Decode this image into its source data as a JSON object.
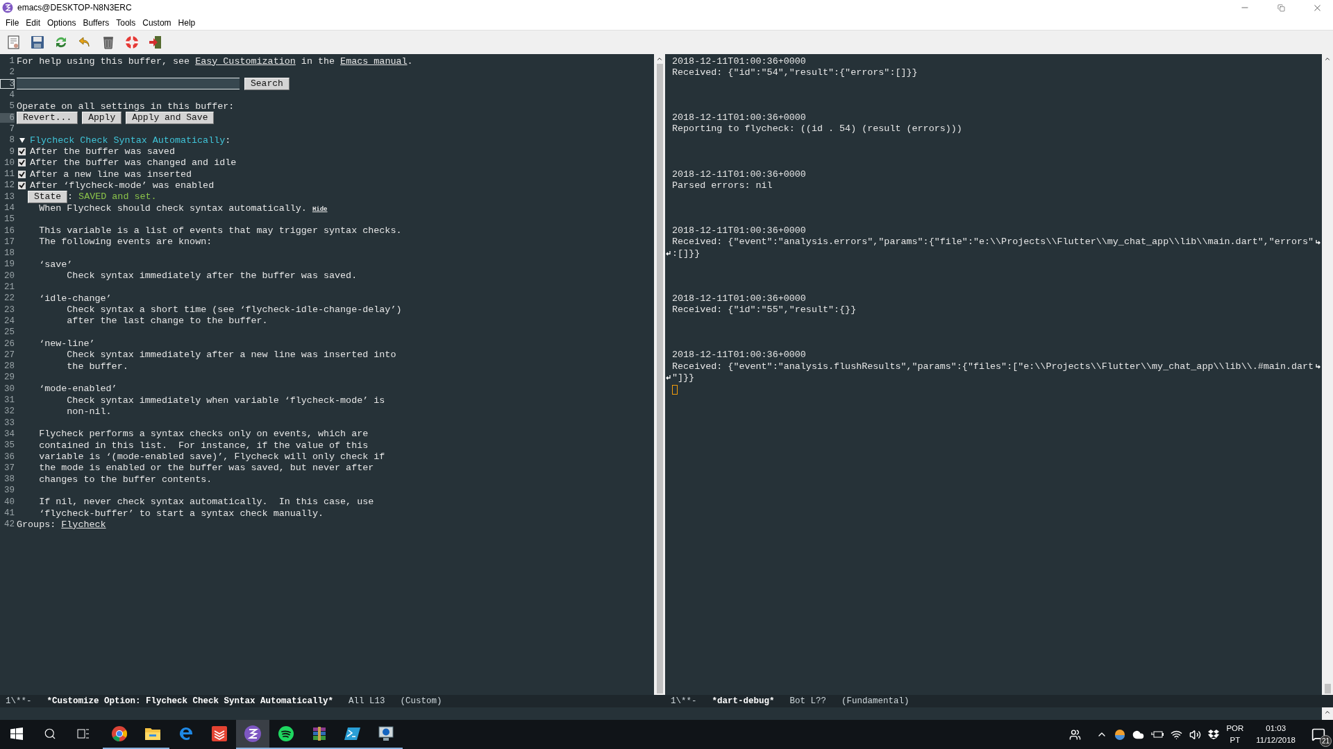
{
  "window": {
    "title": "emacs@DESKTOP-N8N3ERC"
  },
  "menu": [
    "File",
    "Edit",
    "Options",
    "Buffers",
    "Tools",
    "Custom",
    "Help"
  ],
  "left_buffer": {
    "lines": [
      {
        "number": "1",
        "kind": "text",
        "parts": [
          {
            "text": "For help using this buffer, see "
          },
          {
            "text": "Easy Customization",
            "link": true
          },
          {
            "text": " in the "
          },
          {
            "text": "Emacs manual",
            "link": true
          },
          {
            "text": "."
          }
        ]
      },
      {
        "number": "2",
        "kind": "blank"
      },
      {
        "number": "3",
        "kind": "search",
        "cursor": true,
        "button": "Search"
      },
      {
        "number": "4",
        "kind": "blank"
      },
      {
        "number": "5",
        "kind": "text",
        "parts": [
          {
            "text": "Operate on all settings in this buffer:"
          }
        ]
      },
      {
        "number": "6",
        "kind": "buttons",
        "marked": true,
        "buttons": [
          "Revert...",
          "Apply",
          "Apply and Save"
        ]
      },
      {
        "number": "7",
        "kind": "blank"
      },
      {
        "number": "8",
        "kind": "heading",
        "expanded": true,
        "title": "Flycheck Check Syntax Automatically",
        "suffix": ":"
      },
      {
        "number": "9",
        "kind": "checkbox",
        "checked": true,
        "label": "After the buffer was saved"
      },
      {
        "number": "10",
        "kind": "checkbox",
        "checked": true,
        "label": "After the buffer was changed and idle"
      },
      {
        "number": "11",
        "kind": "checkbox",
        "checked": true,
        "label": "After a new line was inserted"
      },
      {
        "number": "12",
        "kind": "checkbox",
        "checked": true,
        "label": "After ‘flycheck-mode’ was enabled"
      },
      {
        "number": "13",
        "kind": "state",
        "button": "State",
        "separator": ":",
        "status": "SAVED and set."
      },
      {
        "number": "14",
        "kind": "text",
        "parts": [
          {
            "text": "    When Flycheck should check syntax automatically. "
          },
          {
            "text": "Hide",
            "link": true,
            "small": true
          }
        ]
      },
      {
        "number": "15",
        "kind": "blank"
      },
      {
        "number": "16",
        "kind": "text",
        "parts": [
          {
            "text": "    This variable is a list of events that may trigger syntax checks."
          }
        ]
      },
      {
        "number": "17",
        "kind": "text",
        "parts": [
          {
            "text": "    The following events are known:"
          }
        ]
      },
      {
        "number": "18",
        "kind": "blank"
      },
      {
        "number": "19",
        "kind": "text",
        "parts": [
          {
            "text": "    ‘save’"
          }
        ]
      },
      {
        "number": "20",
        "kind": "text",
        "parts": [
          {
            "text": "         Check syntax immediately after the buffer was saved."
          }
        ]
      },
      {
        "number": "21",
        "kind": "blank"
      },
      {
        "number": "22",
        "kind": "text",
        "parts": [
          {
            "text": "    ‘idle-change’"
          }
        ]
      },
      {
        "number": "23",
        "kind": "text",
        "parts": [
          {
            "text": "         Check syntax a short time (see ‘flycheck-idle-change-delay’)"
          }
        ]
      },
      {
        "number": "24",
        "kind": "text",
        "parts": [
          {
            "text": "         after the last change to the buffer."
          }
        ]
      },
      {
        "number": "25",
        "kind": "blank"
      },
      {
        "number": "26",
        "kind": "text",
        "parts": [
          {
            "text": "    ‘new-line’"
          }
        ]
      },
      {
        "number": "27",
        "kind": "text",
        "parts": [
          {
            "text": "         Check syntax immediately after a new line was inserted into"
          }
        ]
      },
      {
        "number": "28",
        "kind": "text",
        "parts": [
          {
            "text": "         the buffer."
          }
        ]
      },
      {
        "number": "29",
        "kind": "blank"
      },
      {
        "number": "30",
        "kind": "text",
        "parts": [
          {
            "text": "    ‘mode-enabled’"
          }
        ]
      },
      {
        "number": "31",
        "kind": "text",
        "parts": [
          {
            "text": "         Check syntax immediately when variable ‘flycheck-mode’ is"
          }
        ]
      },
      {
        "number": "32",
        "kind": "text",
        "parts": [
          {
            "text": "         non-nil."
          }
        ]
      },
      {
        "number": "33",
        "kind": "blank"
      },
      {
        "number": "34",
        "kind": "text",
        "parts": [
          {
            "text": "    Flycheck performs a syntax checks only on events, which are"
          }
        ]
      },
      {
        "number": "35",
        "kind": "text",
        "parts": [
          {
            "text": "    contained in this list.  For instance, if the value of this"
          }
        ]
      },
      {
        "number": "36",
        "kind": "text",
        "parts": [
          {
            "text": "    variable is ‘(mode-enabled save)’, Flycheck will only check if"
          }
        ]
      },
      {
        "number": "37",
        "kind": "text",
        "parts": [
          {
            "text": "    the mode is enabled or the buffer was saved, but never after"
          }
        ]
      },
      {
        "number": "38",
        "kind": "text",
        "parts": [
          {
            "text": "    changes to the buffer contents."
          }
        ]
      },
      {
        "number": "39",
        "kind": "blank"
      },
      {
        "number": "40",
        "kind": "text",
        "parts": [
          {
            "text": "    If nil, never check syntax automatically.  In this case, use"
          }
        ]
      },
      {
        "number": "41",
        "kind": "text",
        "parts": [
          {
            "text": "    ‘flycheck-buffer’ to start a syntax check manually."
          }
        ]
      },
      {
        "number": "42",
        "kind": "text",
        "parts": [
          {
            "text": "Groups: "
          },
          {
            "text": "Flycheck",
            "link": true
          }
        ]
      }
    ]
  },
  "right_buffer": {
    "entries": [
      {
        "timestamp": "2018-12-11T01:00:36+0000",
        "lines": [
          "Received: {\"id\":\"54\",\"result\":{\"errors\":[]}}"
        ]
      },
      {
        "timestamp": "2018-12-11T01:00:36+0000",
        "lines": [
          "Reporting to flycheck: ((id . 54) (result (errors)))"
        ]
      },
      {
        "timestamp": "2018-12-11T01:00:36+0000",
        "lines": [
          "Parsed errors: nil"
        ]
      },
      {
        "timestamp": "2018-12-11T01:00:36+0000",
        "lines": [
          "Received: {\"event\":\"analysis.errors\",\"params\":{\"file\":\"e:\\\\Projects\\\\Flutter\\\\my_chat_app\\\\lib\\\\main.dart\",\"errors\"",
          ":[]}}"
        ]
      },
      {
        "timestamp": "2018-12-11T01:00:36+0000",
        "lines": [
          "Received: {\"id\":\"55\",\"result\":{}}"
        ]
      },
      {
        "timestamp": "2018-12-11T01:00:36+0000",
        "lines": [
          "Received: {\"event\":\"analysis.flushResults\",\"params\":{\"files\":[\"e:\\\\Projects\\\\Flutter\\\\my_chat_app\\\\lib\\\\.#main.dart",
          "\"]}}"
        ]
      }
    ]
  },
  "mode_lines": [
    {
      "status": "1\\**-",
      "buffer": "*Customize Option: Flycheck Check Syntax Automatically*",
      "position": "All L13",
      "mode": "(Custom)"
    },
    {
      "status": "1\\**-",
      "buffer": "*dart-debug*",
      "position": "Bot L??",
      "mode": "(Fundamental)"
    }
  ],
  "taskbar": {
    "apps": [
      {
        "kind": "chrome",
        "running": true,
        "selected": false
      },
      {
        "kind": "explorer",
        "running": true,
        "selected": false
      },
      {
        "kind": "edge",
        "running": false,
        "selected": false
      },
      {
        "kind": "todoist",
        "running": false,
        "selected": false
      },
      {
        "kind": "emacs",
        "running": true,
        "selected": true
      },
      {
        "kind": "spotify",
        "running": true,
        "selected": false
      },
      {
        "kind": "winrar",
        "running": true,
        "selected": false
      },
      {
        "kind": "powershell",
        "running": true,
        "selected": false
      },
      {
        "kind": "remote",
        "running": true,
        "selected": false
      }
    ],
    "language": [
      "POR",
      "PT"
    ],
    "time": "01:03",
    "date": "11/12/2018",
    "notifications": "21"
  }
}
